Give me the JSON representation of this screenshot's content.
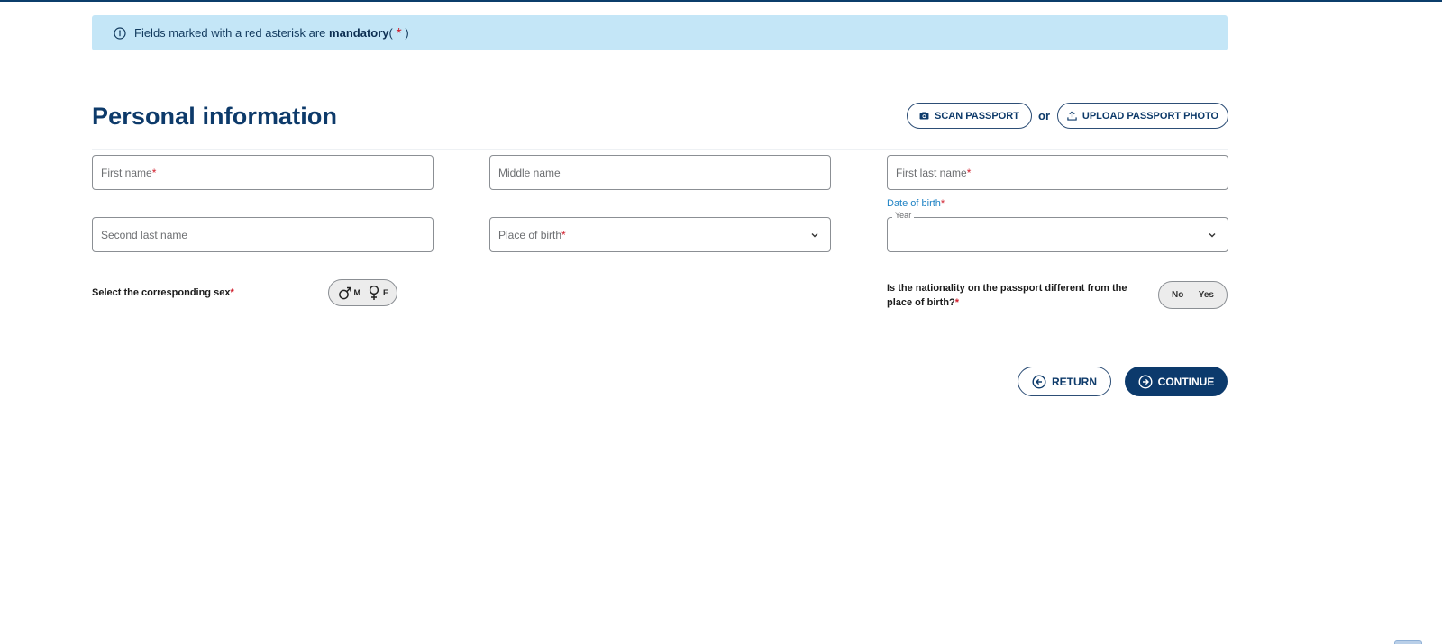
{
  "banner": {
    "text": "Fields marked with a red asterisk are",
    "bold": "mandatory",
    "open": "(",
    "asterisk": "*",
    "close": ")"
  },
  "page": {
    "title": "Personal information"
  },
  "actions": {
    "scan_label": "SCAN PASSPORT",
    "or_label": "or",
    "upload_label": "UPLOAD PASSPORT PHOTO"
  },
  "fields": {
    "first_name": {
      "placeholder": "First name",
      "required": "*"
    },
    "middle_name": {
      "placeholder": "Middle name"
    },
    "first_last_name": {
      "placeholder": "First last name",
      "required": "*"
    },
    "second_last_name": {
      "placeholder": "Second last name"
    },
    "place_of_birth": {
      "placeholder": "Place of birth",
      "required": "*"
    },
    "date_of_birth": {
      "label": "Date of birth",
      "required": "*",
      "legend": "Year",
      "value": ""
    }
  },
  "sex": {
    "label": "Select the corresponding sex",
    "required": "*",
    "male": "M",
    "female": "F"
  },
  "nationality": {
    "label": "Is the nationality on the passport different from the place of birth?",
    "required": "*",
    "no": "No",
    "yes": "Yes"
  },
  "nav": {
    "return_label": "RETURN",
    "continue_label": "CONTINUE"
  },
  "icons": {
    "info": "info-circle-icon",
    "camera": "camera-icon",
    "upload": "upload-icon",
    "chevron": "chevron-down-icon",
    "male": "male-symbol-icon",
    "female": "female-symbol-icon",
    "return": "arrow-left-circle-icon",
    "continue": "arrow-right-circle-icon"
  },
  "colors": {
    "brand": "#0c3a6c",
    "banner_bg": "#c4e6f7",
    "required": "#d0202e",
    "date_label": "#1e82c4"
  }
}
